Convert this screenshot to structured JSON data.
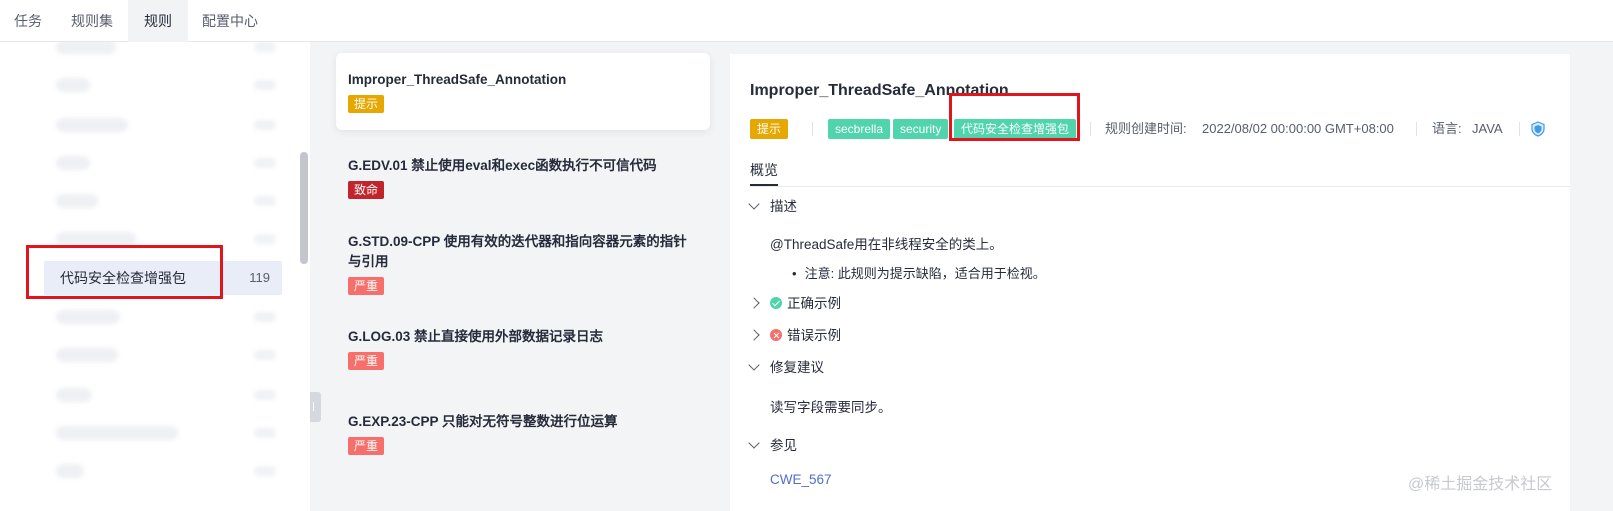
{
  "top_tabs": [
    {
      "label": "任务",
      "active": false
    },
    {
      "label": "规则集",
      "active": false
    },
    {
      "label": "规则",
      "active": true
    },
    {
      "label": "配置中心",
      "active": false
    }
  ],
  "sidebar": {
    "selected": {
      "label": "代码安全检查增强包",
      "count": "119"
    }
  },
  "rule_list": [
    {
      "title": "Improper_ThreadSafe_Annotation",
      "severity": "提示",
      "severity_type": "hint",
      "active": true
    },
    {
      "title": "G.EDV.01 禁止使用eval和exec函数执行不可信代码",
      "severity": "致命",
      "severity_type": "fatal",
      "active": false
    },
    {
      "title": "G.STD.09-CPP 使用有效的迭代器和指向容器元素的指针与引用",
      "severity": "严重",
      "severity_type": "serious",
      "active": false
    },
    {
      "title": "G.LOG.03 禁止直接使用外部数据记录日志",
      "severity": "严重",
      "severity_type": "serious",
      "active": false
    },
    {
      "title": "G.EXP.23-CPP 只能对无符号整数进行位运算",
      "severity": "严重",
      "severity_type": "serious",
      "active": false
    }
  ],
  "detail": {
    "title": "Improper_ThreadSafe_Annotation",
    "severity": "提示",
    "tags": [
      "secbrella",
      "security",
      "代码安全检查增强包"
    ],
    "created_label": "规则创建时间:",
    "created_value": "2022/08/02 00:00:00 GMT+08:00",
    "language_label": "语言:",
    "language_value": "JAVA",
    "shield_icon": "shield-icon",
    "tab": "概览",
    "sections": {
      "description": {
        "title": "描述",
        "text": "@ThreadSafe用在非线程安全的类上。",
        "note": "注意: 此规则为提示缺陷，适合用于检视。"
      },
      "correct_example": {
        "title": "正确示例"
      },
      "wrong_example": {
        "title": "错误示例"
      },
      "fix": {
        "title": "修复建议",
        "text": "读写字段需要同步。"
      },
      "see_also": {
        "title": "参见",
        "link": "CWE_567"
      }
    }
  },
  "watermark": "@稀土掘金技术社区",
  "colors": {
    "hint": "#e6a700",
    "fatal": "#c1252b",
    "serious": "#f66f6a",
    "tag_green": "#50d4ab",
    "highlight_red": "#e0151d",
    "link_blue": "#526ecc"
  }
}
